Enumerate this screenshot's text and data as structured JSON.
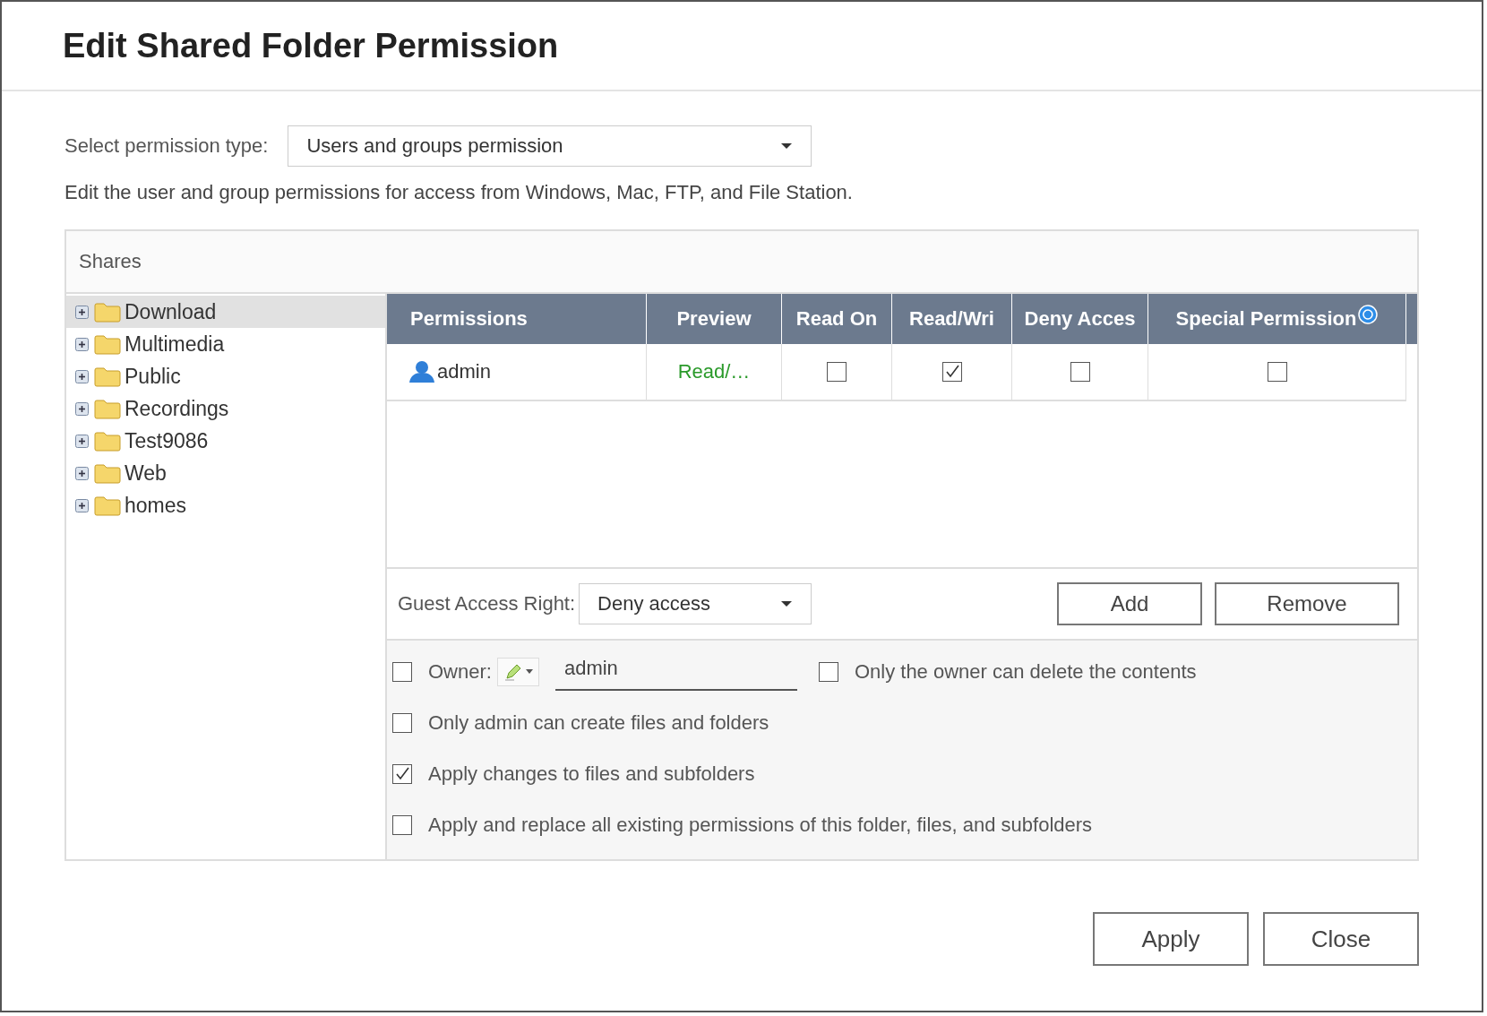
{
  "dialog": {
    "title": "Edit Shared Folder Permission"
  },
  "permission_type": {
    "label": "Select permission type:",
    "value": "Users and groups permission"
  },
  "description": "Edit the user and group permissions for access from Windows, Mac, FTP, and File Station.",
  "shares": {
    "header": "Shares",
    "items": [
      {
        "label": "Download",
        "selected": true,
        "expanded": false
      },
      {
        "label": "Multimedia",
        "selected": false,
        "expanded": false
      },
      {
        "label": "Public",
        "selected": false,
        "expanded": false
      },
      {
        "label": "Recordings",
        "selected": false,
        "expanded": false
      },
      {
        "label": "Test9086",
        "selected": false,
        "expanded": false
      },
      {
        "label": "Web",
        "selected": false,
        "expanded": false
      },
      {
        "label": "homes",
        "selected": false,
        "expanded": false
      }
    ]
  },
  "table": {
    "columns": [
      "Permissions",
      "Preview",
      "Read On",
      "Read/Wri",
      "Deny Acces",
      "Special Permission"
    ],
    "rows": [
      {
        "name": "admin",
        "preview": "Read/…",
        "read_only": false,
        "read_write": true,
        "deny": false,
        "special": false
      }
    ]
  },
  "guest_access": {
    "label": "Guest Access Right:",
    "value": "Deny access"
  },
  "actions": [
    "Add",
    "Remove"
  ],
  "owner": {
    "checked": false,
    "label": "Owner:",
    "value": "admin",
    "delete_option": {
      "label": "Only the owner can delete the contents",
      "checked": false
    }
  },
  "options": [
    {
      "label": "Only admin can create files and folders",
      "checked": false
    },
    {
      "label": "Apply changes to files and subfolders",
      "checked": true
    },
    {
      "label": "Apply and replace all existing permissions of this folder, files, and subfolders",
      "checked": false
    }
  ],
  "buttons": [
    "Apply",
    "Close"
  ]
}
